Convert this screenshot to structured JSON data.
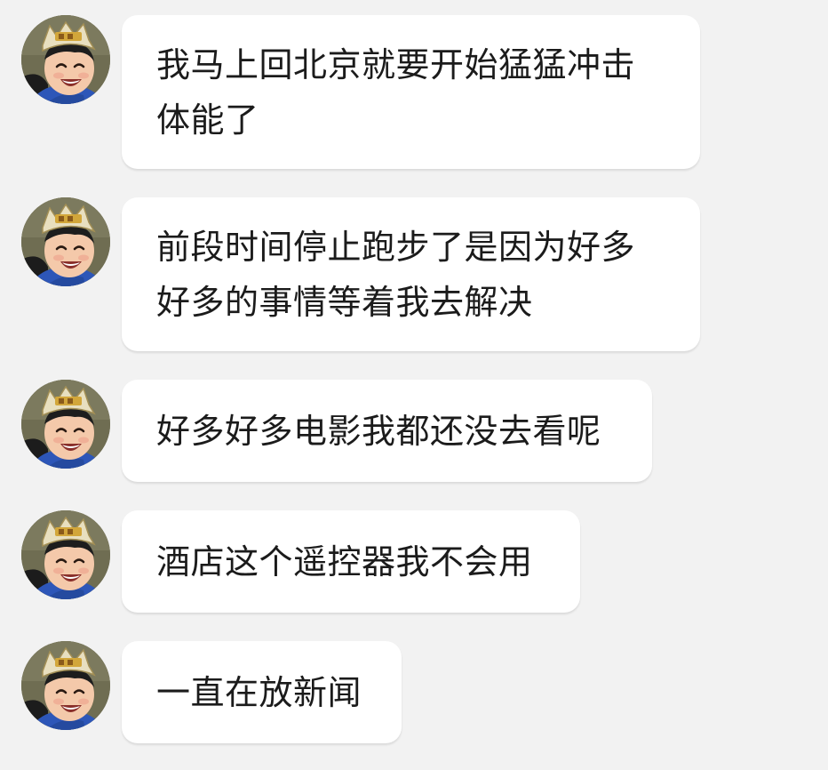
{
  "conversation": {
    "messages": [
      {
        "sender_avatar": "child-avatar",
        "text": "我马上回北京就要开始猛猛冲击体能了"
      },
      {
        "sender_avatar": "child-avatar",
        "text": "前段时间停止跑步了是因为好多好多的事情等着我去解决"
      },
      {
        "sender_avatar": "child-avatar",
        "text": "好多好多电影我都还没去看呢"
      },
      {
        "sender_avatar": "child-avatar",
        "text": "酒店这个遥控器我不会用"
      },
      {
        "sender_avatar": "child-avatar",
        "text": "一直在放新闻"
      }
    ]
  },
  "colors": {
    "background": "#f2f2f2",
    "bubble": "#ffffff",
    "text": "#1b1b1b"
  }
}
